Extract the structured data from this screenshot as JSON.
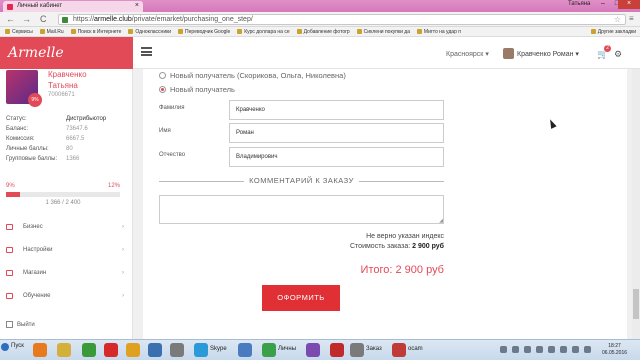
{
  "browser": {
    "tab_title": "Личный кабинет",
    "tab_close": "×",
    "user_name": "Татьяна",
    "window_minimize": "–",
    "window_maximize": "□",
    "window_close": "×",
    "url_host": "armelle.club",
    "url_prefix": "https://",
    "url_path": "/private/emarket/purchasing_one_step/",
    "bookmarks": [
      "Сервисы",
      "Mail.Ru",
      "Поиск в Интернете",
      "Одноклассники",
      "Переводчик Google",
      "Курс доллара на се",
      "Добавление фотогр",
      "Сиклени покупки да",
      "Мигто на удар п",
      "Другие закладки"
    ],
    "nav_back": "←",
    "nav_forward": "→",
    "nav_reload": "C",
    "bookmark_star": "☆",
    "menu_glyph": "≡"
  },
  "header": {
    "logo": "Armelle",
    "city": "Красноярск ▾",
    "user": "Кравченко Роман ▾",
    "cart_count": "2",
    "cart_glyph": "🛒",
    "settings_glyph": "⚙"
  },
  "sidebar": {
    "badge": "9%",
    "name_line1": "Кравченко",
    "name_line2": "Татьяна",
    "id": "70006671",
    "stats": [
      {
        "key": "Статус:",
        "value": "Дистрибьютор"
      },
      {
        "key": "Баланс:",
        "value": "73647.6"
      },
      {
        "key": "Комиссия:",
        "value": "6667.5"
      },
      {
        "key": "Личные баллы:",
        "value": "80"
      },
      {
        "key": "Групповые баллы:",
        "value": "1366"
      }
    ],
    "progress_left": "9%",
    "progress_right": "12%",
    "progress_fraction": 0.12,
    "progress_text": "1 366 / 2 400",
    "menu": [
      "Бизнес",
      "Настройки",
      "Магазин",
      "Обучение"
    ],
    "menu_arrow": "›",
    "logout": "Выйти"
  },
  "order": {
    "recipient_new_example": "Новый получатель (Скорикова, Ольга, Николевна)",
    "recipient_new": "Новый получатель",
    "fields": [
      {
        "label": "Фамилия",
        "value": "Кравченко"
      },
      {
        "label": "Имя",
        "value": "Роман"
      },
      {
        "label": "Отчество",
        "value": "Владимирович"
      }
    ],
    "comment_heading": "КОММЕНТАРИЙ К ЗАКАЗУ",
    "comment_value": "",
    "resize_grip": "◢",
    "warning": "Не верно указан индекс",
    "cost_label": "Стоимость заказа:",
    "cost_value": "2 900 руб",
    "total": "Итого: 2 900 руб",
    "submit": "ОФОРМИТЬ"
  },
  "taskbar": {
    "start": "Пуск",
    "items": [
      "Skype",
      "Личны",
      "Заказ",
      "ocam"
    ],
    "time": "18:27",
    "date": "06.05.2016"
  },
  "colors": {
    "accent": "#e24a58",
    "button": "#e03036",
    "titlebar": "#d678bb"
  }
}
